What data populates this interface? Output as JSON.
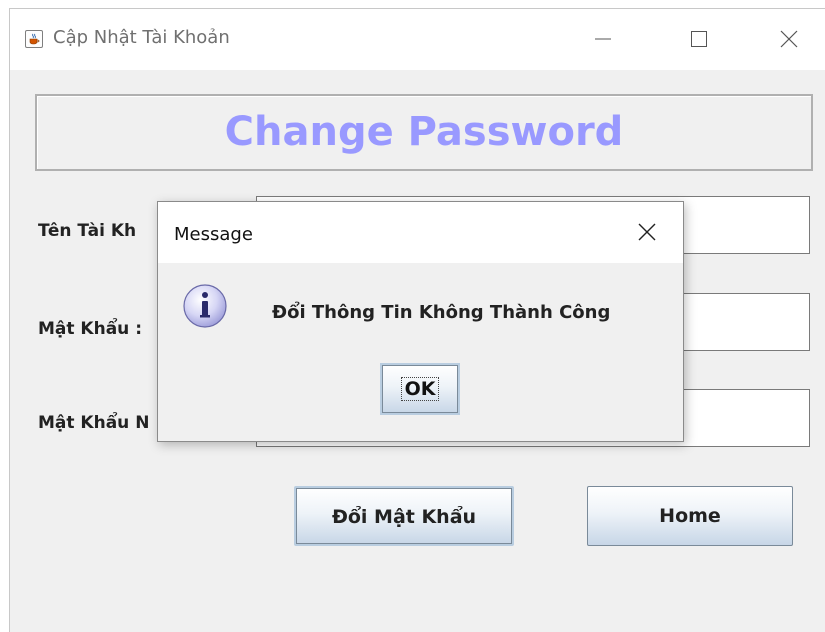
{
  "window": {
    "title": "Cập Nhật Tài Khoản",
    "icon": "java-cup-icon"
  },
  "header": {
    "title": "Change Password",
    "title_color": "#9999ff"
  },
  "form": {
    "username_label": "Tên Tài Kh",
    "username_value": "",
    "password_label": "Mật Khẩu :",
    "password_value": "",
    "new_password_label": "Mật Khẩu N",
    "new_password_value": ""
  },
  "buttons": {
    "change_label": "Đổi Mật Khẩu",
    "home_label": "Home"
  },
  "dialog": {
    "title": "Message",
    "icon": "info-icon",
    "message": "Đổi Thông Tin Không Thành Công",
    "ok_label": "OK"
  }
}
